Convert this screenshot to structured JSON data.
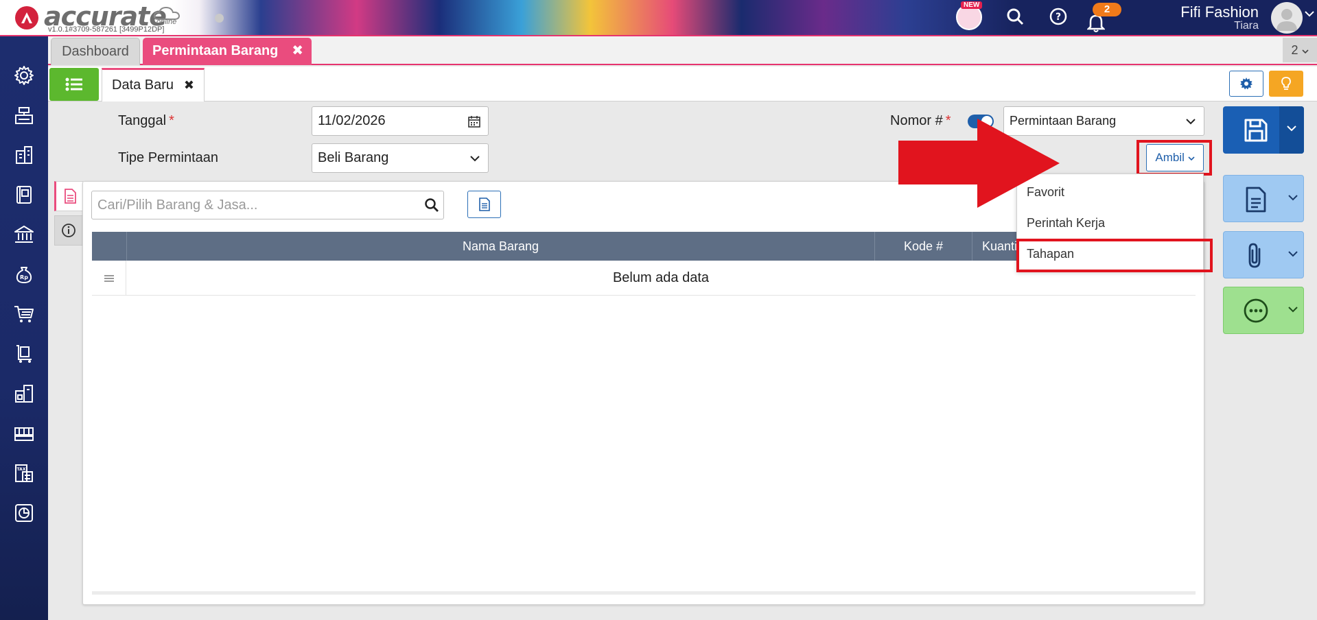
{
  "header": {
    "logo_text": "accurate",
    "logo_sub": "online",
    "version": "v1.0.1#3709-587261 [3499P12DP]",
    "new_badge": "NEW",
    "notification_count": "2",
    "user_name": "Fifi Fashion",
    "user_sub": "Tiara"
  },
  "tabs": {
    "dashboard": "Dashboard",
    "active": "Permintaan Barang",
    "close_glyph": "✖",
    "count": "2"
  },
  "subtab": {
    "label": "Data Baru",
    "close_glyph": "✖"
  },
  "form": {
    "tanggal_label": "Tanggal",
    "tanggal_value": "11/02/2026",
    "tipe_label": "Tipe Permintaan",
    "tipe_value": "Beli Barang",
    "nomor_label": "Nomor #",
    "nomor_value": "Permintaan Barang",
    "required_mark": "*"
  },
  "detail": {
    "search_placeholder": "Cari/Pilih Barang & Jasa...",
    "columns": [
      "Nama Barang",
      "Kode #",
      "Kuantitas"
    ],
    "empty_text": "Belum ada data"
  },
  "ambil": {
    "label": "Ambil",
    "items": [
      "Favorit",
      "Perintah Kerja",
      "Tahapan"
    ]
  },
  "colors": {
    "accent_pink": "#ea4c7e",
    "primary_blue": "#1a5fb4",
    "sidebar_navy": "#1d2d6e",
    "highlight_red": "#e1141e"
  },
  "icons": {
    "sidebar": [
      "gear-icon",
      "cash-register-icon",
      "building-icon",
      "ledger-book-icon",
      "bank-icon",
      "money-bag-icon",
      "shopping-cart-icon",
      "trolley-box-icon",
      "warehouse-icon",
      "factory-icon",
      "tax-icon",
      "report-chart-icon"
    ]
  }
}
